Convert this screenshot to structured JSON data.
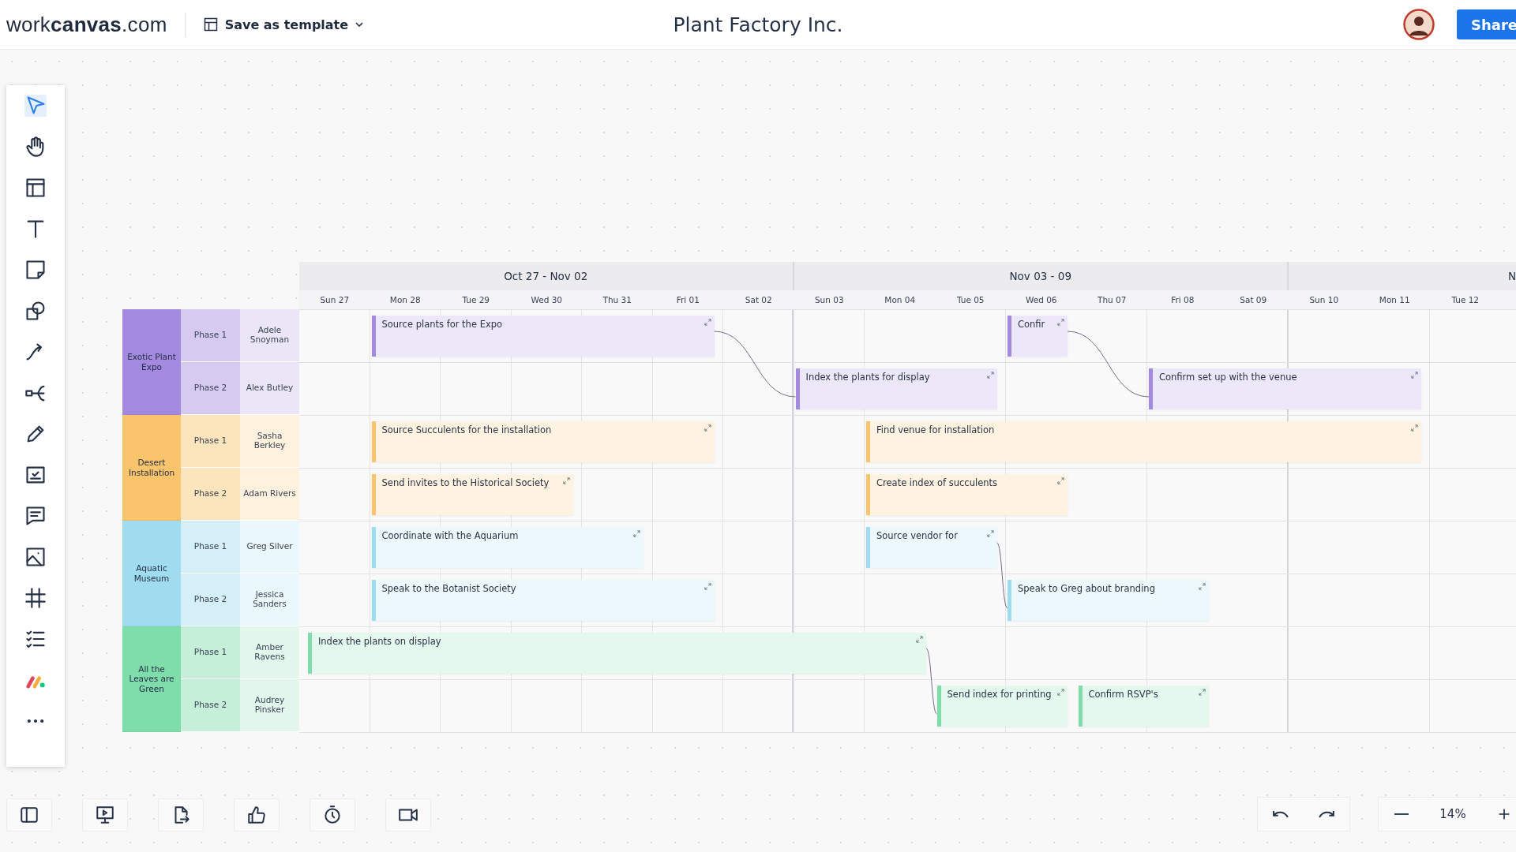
{
  "header": {
    "logo": "work**canvas**.com",
    "template_button": "Save as template",
    "title": "Plant Factory Inc.",
    "share_button": "Share"
  },
  "toolbar": {
    "tools": [
      {
        "selected": true
      },
      {
        "selected": false
      },
      {
        "selected": false
      },
      {
        "selected": false
      },
      {
        "selected": false
      },
      {
        "selected": false
      },
      {
        "selected": false
      },
      {
        "selected": false
      },
      {
        "selected": false
      },
      {
        "selected": false
      },
      {
        "selected": false
      },
      {
        "selected": false
      },
      {
        "selected": false
      },
      {
        "selected": false
      },
      {
        "selected": false
      },
      {
        "selected": false
      }
    ]
  },
  "timeline": {
    "weeks": [
      {
        "label": "Oct 27 - Nov 02"
      },
      {
        "label": "Nov 03 - 09"
      },
      {
        "label": "N"
      }
    ],
    "days": [
      {
        "label": "Sun 27"
      },
      {
        "label": "Mon 28"
      },
      {
        "label": "Tue 29"
      },
      {
        "label": "Wed 30"
      },
      {
        "label": "Thu 31"
      },
      {
        "label": "Fri 01"
      },
      {
        "label": "Sat 02"
      },
      {
        "label": "Sun 03"
      },
      {
        "label": "Mon 04"
      },
      {
        "label": "Tue 05"
      },
      {
        "label": "Wed 06"
      },
      {
        "label": "Thu 07"
      },
      {
        "label": "Fri 08"
      },
      {
        "label": "Sat 09"
      },
      {
        "label": "Sun 10"
      },
      {
        "label": "Mon 11"
      },
      {
        "label": "Tue 12"
      }
    ]
  },
  "groups": [
    {
      "name": "Exotic Plant Expo",
      "color": "#a38ae0",
      "phases": [
        {
          "label": "Phase 1",
          "owner": "Adele Snoyman",
          "tasks": [
            {
              "title": "Source plants for the Expo"
            },
            {
              "title": "Confir"
            }
          ]
        },
        {
          "label": "Phase 2",
          "owner": "Alex Butley",
          "tasks": [
            {
              "title": "Index the plants for display"
            },
            {
              "title": "Confirm set up with the venue"
            }
          ]
        }
      ]
    },
    {
      "name": "Desert Installation",
      "color": "#f9c46b",
      "phases": [
        {
          "label": "Phase 1",
          "owner": "Sasha Berkley",
          "tasks": [
            {
              "title": "Source Succulents for the installation"
            },
            {
              "title": "Find venue for installation"
            }
          ]
        },
        {
          "label": "Phase 2",
          "owner": "Adam Rivers",
          "tasks": [
            {
              "title": "Send invites to the Historical Society"
            },
            {
              "title": "Create index of succulents"
            }
          ]
        }
      ]
    },
    {
      "name": "Aquatic Museum",
      "color": "#9fdcef",
      "phases": [
        {
          "label": "Phase 1",
          "owner": "Greg Silver",
          "tasks": [
            {
              "title": "Coordinate with the Aquarium"
            },
            {
              "title": "Source vendor for"
            }
          ]
        },
        {
          "label": "Phase 2",
          "owner": "Jessica Sanders",
          "tasks": [
            {
              "title": "Speak to the Botanist Society"
            },
            {
              "title": "Speak to Greg about branding"
            }
          ]
        }
      ]
    },
    {
      "name": "All the Leaves are Green",
      "color": "#7fdcab",
      "phases": [
        {
          "label": "Phase 1",
          "owner": "Amber Ravens",
          "tasks": [
            {
              "title": "Index the plants on display"
            }
          ]
        },
        {
          "label": "Phase 2",
          "owner": "Audrey Pinsker",
          "tasks": [
            {
              "title": "Send index for printing"
            },
            {
              "title": "Confirm RSVP's"
            }
          ]
        }
      ]
    }
  ],
  "zoom": {
    "value": "14%"
  }
}
